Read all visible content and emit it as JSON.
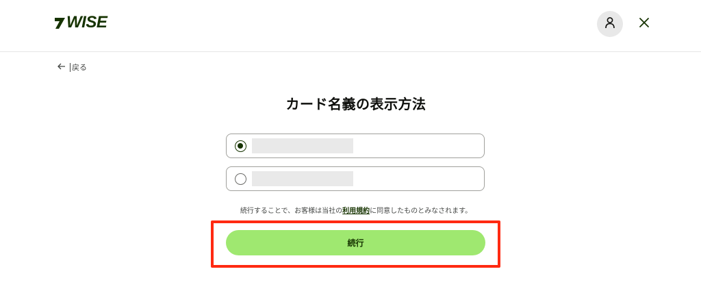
{
  "header": {
    "logo_text": "WISE",
    "account_icon": "person-icon",
    "close_icon": "close-icon"
  },
  "nav": {
    "back_label": "戻る"
  },
  "main": {
    "title": "カード名義の表示方法",
    "options": [
      {
        "selected": true,
        "label": ""
      },
      {
        "selected": false,
        "label": ""
      }
    ],
    "consent": {
      "before": "続行することで、お客様は当社の",
      "link": "利用規約",
      "after": "に同意したものとみなされます。"
    },
    "continue_label": "続行"
  },
  "colors": {
    "brand_green": "#163300",
    "button_green": "#9fe870",
    "highlight_red": "#ff2a12"
  }
}
